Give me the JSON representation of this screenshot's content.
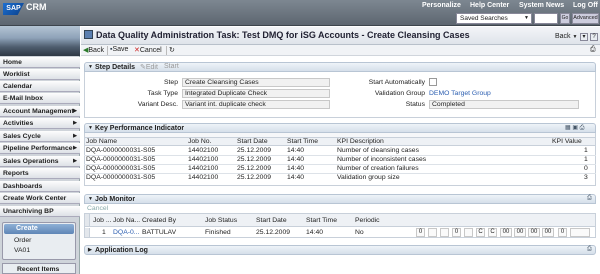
{
  "app": {
    "logo": "SAP",
    "name": "CRM"
  },
  "top_links": [
    "Personalize",
    "Help Center",
    "System News",
    "Log Off"
  ],
  "saved_searches": {
    "label": "Saved Searches",
    "go": "Go",
    "advanced": "Advanced"
  },
  "sidebar": {
    "items": [
      "Home",
      "Worklist",
      "Calendar",
      "E-Mail Inbox",
      "Account Management",
      "Activities",
      "Sales Cycle",
      "Pipeline Performance",
      "Sales Operations",
      "Reports",
      "Dashboards",
      "Create Work Center",
      "Unarchiving BP"
    ],
    "create": {
      "label": "Create",
      "items": [
        "Order",
        "VA01"
      ]
    },
    "recent": "Recent Items"
  },
  "page": {
    "title": "Data Quality Administration Task: Test DMQ for iSG Accounts - Create Cleansing Cases",
    "back": "Back"
  },
  "toolbar": {
    "back": "Back",
    "save": "Save",
    "cancel": "Cancel"
  },
  "step_details": {
    "title": "Step Details",
    "edit": "Edit",
    "start": "Start",
    "step_label": "Step",
    "step": "Create Cleansing Cases",
    "task_type_label": "Task Type",
    "task_type": "Integrated Duplicate Check",
    "variant_label": "Variant Desc.",
    "variant": "Variant int. duplicate check",
    "start_auto_label": "Start Automatically",
    "validation_group_label": "Validation Group",
    "validation_group": "DEMO Target Group",
    "status_label": "Status",
    "status": "Completed"
  },
  "kpi": {
    "title": "Key Performance Indicator",
    "columns": [
      "Job Name",
      "Job No.",
      "Start Date",
      "Start Time",
      "KPI Description",
      "KPI Value"
    ],
    "rows": [
      [
        "DQA-0000000031-S05",
        "14402100",
        "25.12.2009",
        "14:40",
        "Number of cleansing cases",
        "1"
      ],
      [
        "DQA-0000000031-S05",
        "14402100",
        "25.12.2009",
        "14:40",
        "Number of inconsistent cases",
        "1"
      ],
      [
        "DQA-0000000031-S05",
        "14402100",
        "25.12.2009",
        "14:40",
        "Number of creation failures",
        "0"
      ],
      [
        "DQA-0000000031-S05",
        "14402100",
        "25.12.2009",
        "14:40",
        "Validation group size",
        "3"
      ]
    ]
  },
  "job_monitor": {
    "title": "Job Monitor",
    "cancel": "Cancel",
    "columns": [
      "Job ...",
      "Job Na...",
      "Created By",
      "Job Status",
      "Start Date",
      "Start Time",
      "Periodic"
    ],
    "row": [
      "1",
      "DQA-0...",
      "BATTULAV",
      "Finished",
      "25.12.2009",
      "14:40",
      "No"
    ],
    "boxes": [
      "0",
      "",
      "",
      "0",
      "",
      "C",
      "C",
      "00",
      "00",
      "00",
      "00",
      "0",
      ""
    ]
  },
  "app_log": {
    "title": "Application Log"
  },
  "colors": {
    "accent": "#2a5db0",
    "topbar": "#6a737c"
  }
}
